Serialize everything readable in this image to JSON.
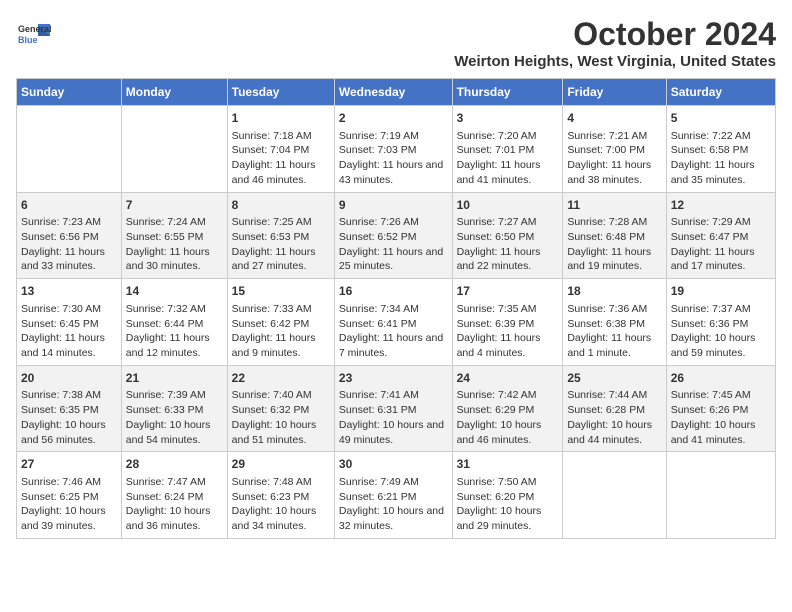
{
  "header": {
    "logo_line1": "General",
    "logo_line2": "Blue",
    "month": "October 2024",
    "location": "Weirton Heights, West Virginia, United States"
  },
  "days_of_week": [
    "Sunday",
    "Monday",
    "Tuesday",
    "Wednesday",
    "Thursday",
    "Friday",
    "Saturday"
  ],
  "weeks": [
    [
      {
        "day": "",
        "content": ""
      },
      {
        "day": "",
        "content": ""
      },
      {
        "day": "1",
        "content": "Sunrise: 7:18 AM\nSunset: 7:04 PM\nDaylight: 11 hours and 46 minutes."
      },
      {
        "day": "2",
        "content": "Sunrise: 7:19 AM\nSunset: 7:03 PM\nDaylight: 11 hours and 43 minutes."
      },
      {
        "day": "3",
        "content": "Sunrise: 7:20 AM\nSunset: 7:01 PM\nDaylight: 11 hours and 41 minutes."
      },
      {
        "day": "4",
        "content": "Sunrise: 7:21 AM\nSunset: 7:00 PM\nDaylight: 11 hours and 38 minutes."
      },
      {
        "day": "5",
        "content": "Sunrise: 7:22 AM\nSunset: 6:58 PM\nDaylight: 11 hours and 35 minutes."
      }
    ],
    [
      {
        "day": "6",
        "content": "Sunrise: 7:23 AM\nSunset: 6:56 PM\nDaylight: 11 hours and 33 minutes."
      },
      {
        "day": "7",
        "content": "Sunrise: 7:24 AM\nSunset: 6:55 PM\nDaylight: 11 hours and 30 minutes."
      },
      {
        "day": "8",
        "content": "Sunrise: 7:25 AM\nSunset: 6:53 PM\nDaylight: 11 hours and 27 minutes."
      },
      {
        "day": "9",
        "content": "Sunrise: 7:26 AM\nSunset: 6:52 PM\nDaylight: 11 hours and 25 minutes."
      },
      {
        "day": "10",
        "content": "Sunrise: 7:27 AM\nSunset: 6:50 PM\nDaylight: 11 hours and 22 minutes."
      },
      {
        "day": "11",
        "content": "Sunrise: 7:28 AM\nSunset: 6:48 PM\nDaylight: 11 hours and 19 minutes."
      },
      {
        "day": "12",
        "content": "Sunrise: 7:29 AM\nSunset: 6:47 PM\nDaylight: 11 hours and 17 minutes."
      }
    ],
    [
      {
        "day": "13",
        "content": "Sunrise: 7:30 AM\nSunset: 6:45 PM\nDaylight: 11 hours and 14 minutes."
      },
      {
        "day": "14",
        "content": "Sunrise: 7:32 AM\nSunset: 6:44 PM\nDaylight: 11 hours and 12 minutes."
      },
      {
        "day": "15",
        "content": "Sunrise: 7:33 AM\nSunset: 6:42 PM\nDaylight: 11 hours and 9 minutes."
      },
      {
        "day": "16",
        "content": "Sunrise: 7:34 AM\nSunset: 6:41 PM\nDaylight: 11 hours and 7 minutes."
      },
      {
        "day": "17",
        "content": "Sunrise: 7:35 AM\nSunset: 6:39 PM\nDaylight: 11 hours and 4 minutes."
      },
      {
        "day": "18",
        "content": "Sunrise: 7:36 AM\nSunset: 6:38 PM\nDaylight: 11 hours and 1 minute."
      },
      {
        "day": "19",
        "content": "Sunrise: 7:37 AM\nSunset: 6:36 PM\nDaylight: 10 hours and 59 minutes."
      }
    ],
    [
      {
        "day": "20",
        "content": "Sunrise: 7:38 AM\nSunset: 6:35 PM\nDaylight: 10 hours and 56 minutes."
      },
      {
        "day": "21",
        "content": "Sunrise: 7:39 AM\nSunset: 6:33 PM\nDaylight: 10 hours and 54 minutes."
      },
      {
        "day": "22",
        "content": "Sunrise: 7:40 AM\nSunset: 6:32 PM\nDaylight: 10 hours and 51 minutes."
      },
      {
        "day": "23",
        "content": "Sunrise: 7:41 AM\nSunset: 6:31 PM\nDaylight: 10 hours and 49 minutes."
      },
      {
        "day": "24",
        "content": "Sunrise: 7:42 AM\nSunset: 6:29 PM\nDaylight: 10 hours and 46 minutes."
      },
      {
        "day": "25",
        "content": "Sunrise: 7:44 AM\nSunset: 6:28 PM\nDaylight: 10 hours and 44 minutes."
      },
      {
        "day": "26",
        "content": "Sunrise: 7:45 AM\nSunset: 6:26 PM\nDaylight: 10 hours and 41 minutes."
      }
    ],
    [
      {
        "day": "27",
        "content": "Sunrise: 7:46 AM\nSunset: 6:25 PM\nDaylight: 10 hours and 39 minutes."
      },
      {
        "day": "28",
        "content": "Sunrise: 7:47 AM\nSunset: 6:24 PM\nDaylight: 10 hours and 36 minutes."
      },
      {
        "day": "29",
        "content": "Sunrise: 7:48 AM\nSunset: 6:23 PM\nDaylight: 10 hours and 34 minutes."
      },
      {
        "day": "30",
        "content": "Sunrise: 7:49 AM\nSunset: 6:21 PM\nDaylight: 10 hours and 32 minutes."
      },
      {
        "day": "31",
        "content": "Sunrise: 7:50 AM\nSunset: 6:20 PM\nDaylight: 10 hours and 29 minutes."
      },
      {
        "day": "",
        "content": ""
      },
      {
        "day": "",
        "content": ""
      }
    ]
  ]
}
